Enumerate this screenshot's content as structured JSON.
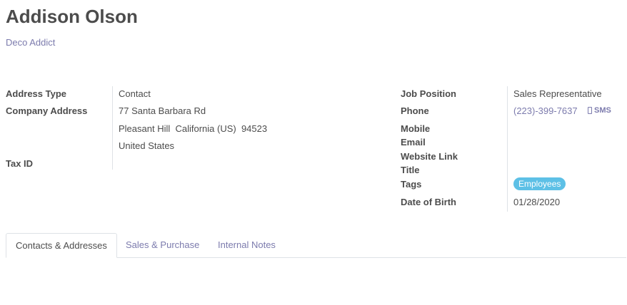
{
  "record": {
    "name": "Addison Olson",
    "company_name": "Deco Addict"
  },
  "left_fields": {
    "address_type_label": "Address Type",
    "address_type_value": "Contact",
    "company_address_label": "Company Address",
    "street": "77 Santa Barbara Rd",
    "city_line": "Pleasant Hill  California (US)  94523",
    "country": "United States",
    "tax_id_label": "Tax ID"
  },
  "right_fields": {
    "job_position_label": "Job Position",
    "job_position_value": "Sales Representative",
    "phone_label": "Phone",
    "phone_value": "(223)-399-7637",
    "sms_label": "SMS",
    "mobile_label": "Mobile",
    "email_label": "Email",
    "website_label": "Website Link",
    "title_label": "Title",
    "tags_label": "Tags",
    "tag_value": "Employees",
    "dob_label": "Date of Birth",
    "dob_value": "01/28/2020"
  },
  "tabs": [
    {
      "label": "Contacts & Addresses",
      "active": true
    },
    {
      "label": "Sales & Purchase",
      "active": false
    },
    {
      "label": "Internal Notes",
      "active": false
    }
  ],
  "colors": {
    "link": "#7c7bad",
    "tag": "#5dc0e6",
    "text": "#4c4c4c"
  }
}
